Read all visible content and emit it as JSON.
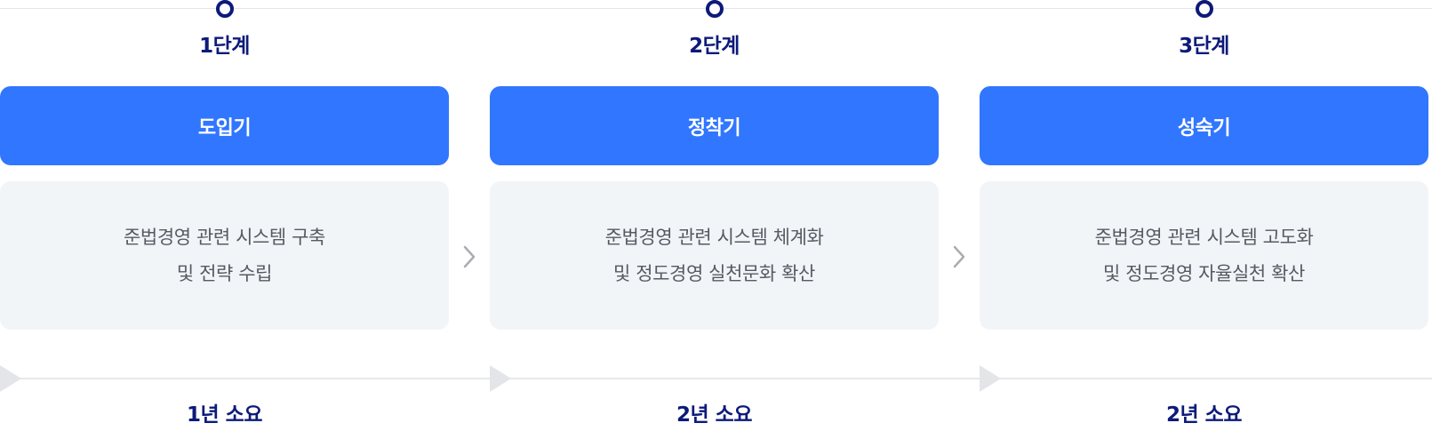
{
  "stages": [
    {
      "step": "1단계",
      "phase": "도입기",
      "desc_line1": "준법경영 관련 시스템 구축",
      "desc_line2": "및 전략 수립",
      "duration": "1년 소요"
    },
    {
      "step": "2단계",
      "phase": "정착기",
      "desc_line1": "준법경영 관련 시스템 체계화",
      "desc_line2": "및 정도경영 실천문화 확산",
      "duration": "2년 소요"
    },
    {
      "step": "3단계",
      "phase": "성숙기",
      "desc_line1": "준법경영 관련 시스템 고도화",
      "desc_line2": "및 정도경영 자율실천 확산",
      "duration": "2년 소요"
    }
  ],
  "icons": {
    "stage_marker": "circle-dot-icon",
    "next": "chevron-right-icon",
    "timeline_marker": "triangle-right-icon"
  },
  "colors": {
    "accent": "#3176ff",
    "navy": "#0c1a7a",
    "panel": "#f2f5f8",
    "text": "#555b63"
  }
}
